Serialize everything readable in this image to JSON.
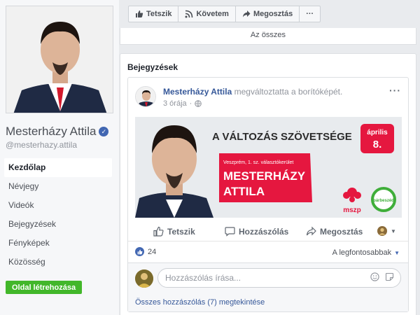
{
  "sidebar": {
    "page_name": "Mesterházy Attila",
    "username": "@mesterhazy.attila",
    "nav": [
      {
        "label": "Kezdőlap",
        "active": true
      },
      {
        "label": "Névjegy"
      },
      {
        "label": "Videók"
      },
      {
        "label": "Bejegyzések"
      },
      {
        "label": "Fényképek"
      },
      {
        "label": "Közösség"
      }
    ],
    "create_page": "Oldal létrehozása"
  },
  "action_bar": {
    "like": "Tetszik",
    "follow": "Követem",
    "share": "Megosztás",
    "more": "···"
  },
  "strip": {
    "all_label": "Az összes"
  },
  "posts": {
    "title": "Bejegyzések",
    "post": {
      "author": "Mesterházy Attila",
      "action": "megváltoztatta a borítóképét.",
      "time": "3 órája",
      "more": "···",
      "cover": {
        "headline": "A VÁLTOZÁS SZÖVETSÉGE",
        "date_month": "április",
        "date_day": "8.",
        "district": "Veszprém, 1. sz. választókerület",
        "name_line1": "MESTERHÁZY",
        "name_line2": "ATTILA",
        "logo_mszp": "mszp",
        "logo_pb": "párbeszéd"
      },
      "actions": {
        "like": "Tetszik",
        "comment": "Hozzászólás",
        "share": "Megosztás"
      },
      "reaction_count": "24",
      "sort_label": "A legfontosabbak",
      "comment_placeholder": "Hozzászólás írása...",
      "view_all_comments": "Összes hozzászólás (7) megtekintése"
    }
  },
  "colors": {
    "fb_blue": "#4267b2",
    "link_blue": "#365899",
    "green": "#42b72a",
    "campaign_red": "#e5173f"
  }
}
